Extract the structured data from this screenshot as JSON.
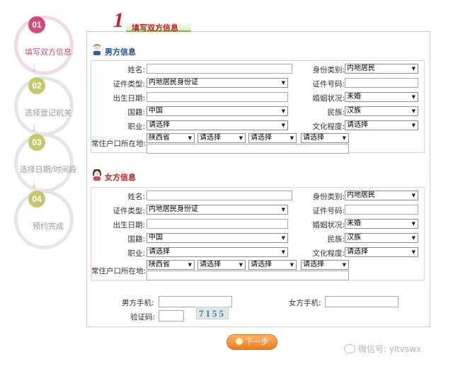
{
  "title": "填写双方信息",
  "title_number": "1",
  "steps": [
    {
      "num": "01",
      "label": "填写双方信息",
      "color": "#d4497b",
      "active": true
    },
    {
      "num": "02",
      "label": "选择登记机关",
      "color": "#c5c76a",
      "active": false
    },
    {
      "num": "03",
      "label": "选择日期/时间段",
      "color": "#c5c76a",
      "active": false
    },
    {
      "num": "04",
      "label": "预约完成",
      "color": "#c5c76a",
      "active": false
    }
  ],
  "male": {
    "heading": "男方信息",
    "heading_color": "#1d4f91",
    "name_label": "姓名:",
    "id_type_label": "证件类型:",
    "id_type_value": "内地居民身份证",
    "birth_label": "出生日期:",
    "nationality_label": "国籍:",
    "nationality_value": "中国",
    "job_label": "职业:",
    "job_value": "请选择",
    "residence_label": "常住户口所在地:",
    "province_value": "陕西省",
    "city_value": "请选择",
    "district_value": "请选择",
    "town_value": "请选择",
    "identity_label": "身份类别:",
    "identity_value": "内地居民",
    "id_number_label": "证件号码:",
    "marital_label": "婚姻状况:",
    "marital_value": "未婚",
    "ethnic_label": "民族:",
    "ethnic_value": "汉族",
    "edu_label": "文化程度:",
    "edu_value": "请选择"
  },
  "female": {
    "heading": "女方信息",
    "heading_color": "#c81d25",
    "name_label": "姓名:",
    "id_type_label": "证件类型:",
    "id_type_value": "内地居民身份证",
    "birth_label": "出生日期:",
    "nationality_label": "国籍:",
    "nationality_value": "中国",
    "job_label": "职业:",
    "job_value": "请选择",
    "residence_label": "常住户口所在地:",
    "province_value": "陕西省",
    "city_value": "请选择",
    "district_value": "请选择",
    "town_value": "请选择",
    "identity_label": "身份类别:",
    "identity_value": "内地居民",
    "id_number_label": "证件号码:",
    "marital_label": "婚姻状况:",
    "marital_value": "未婚",
    "ethnic_label": "民族:",
    "ethnic_value": "汉族",
    "edu_label": "文化程度:",
    "edu_value": "请选择"
  },
  "contact": {
    "male_phone_label": "男方手机:",
    "female_phone_label": "女方手机:",
    "captcha_label": "验证码:",
    "captcha_text": "7155"
  },
  "next_button": "下一步",
  "watermark": "微信号: yltvswx"
}
